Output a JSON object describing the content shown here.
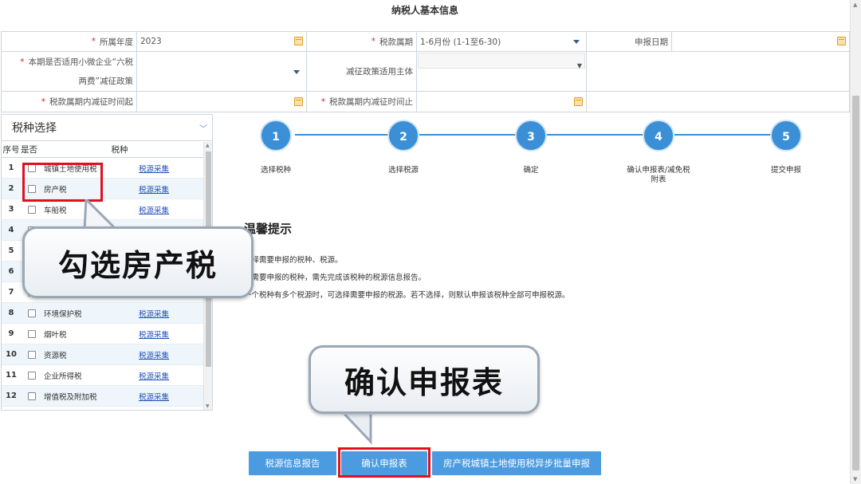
{
  "title": "纳税人基本信息",
  "form": {
    "row1": {
      "year_label": "所属年度",
      "year_value": "2023",
      "period_label": "税款属期",
      "period_value": "1-6月份 (1-1至6-30)",
      "declare_date_label": "申报日期",
      "declare_date_value": ""
    },
    "row2": {
      "policy_label_line1": "本期是否适用小微企业“六税",
      "policy_label_line2": "两费”减征政策",
      "subject_label": "减征政策适用主体"
    },
    "row3": {
      "start_label": "税款属期内减征时间起",
      "end_label": "税款属期内减征时间止"
    }
  },
  "tax_panel": {
    "title": "税种选择",
    "headers": {
      "seq": "序号",
      "check": "是否",
      "name": "税种"
    },
    "rows": [
      {
        "seq": "1",
        "name": "城镇土地使用税",
        "link": "税源采集"
      },
      {
        "seq": "2",
        "name": "房产税",
        "link": "税源采集"
      },
      {
        "seq": "3",
        "name": "车船税",
        "link": "税源采集"
      },
      {
        "seq": "4",
        "name": "",
        "link": ""
      },
      {
        "seq": "5",
        "name": "",
        "link": ""
      },
      {
        "seq": "6",
        "name": "",
        "link": ""
      },
      {
        "seq": "7",
        "name": "",
        "link": ""
      },
      {
        "seq": "8",
        "name": "环境保护税",
        "link": "税源采集"
      },
      {
        "seq": "9",
        "name": "烟叶税",
        "link": "税源采集"
      },
      {
        "seq": "10",
        "name": "资源税",
        "link": "税源采集"
      },
      {
        "seq": "11",
        "name": "企业所得税",
        "link": "税源采集"
      },
      {
        "seq": "12",
        "name": "增值税及附加税",
        "link": "税源采集"
      }
    ]
  },
  "steps": [
    {
      "num": "1",
      "label": "选择税种"
    },
    {
      "num": "2",
      "label": "选择税源"
    },
    {
      "num": "3",
      "label": "确定"
    },
    {
      "num": "4",
      "label": "确认申报表/减免税附表"
    },
    {
      "num": "5",
      "label": "提交申报"
    }
  ],
  "tips": {
    "title": "温馨提示",
    "lines": [
      "选择需要申报的税种、税源。",
      "择需要申报的税种，需先完成该税种的税源信息报告。",
      "一个税种有多个税源时，可选择需要申报的税源。若不选择，则默认申报该税种全部可申报税源。"
    ]
  },
  "callouts": {
    "check_house_tax": "勾选房产税",
    "confirm_form": "确认申报表"
  },
  "buttons": {
    "source_report": "税源信息报告",
    "confirm": "确认申报表",
    "batch": "房产税城镇土地使用税异步批量申报"
  },
  "colors": {
    "primary": "#3a8fd6",
    "button": "#4a9be0",
    "highlight": "#e01020",
    "required": "#e02020",
    "link": "#2250b8"
  }
}
